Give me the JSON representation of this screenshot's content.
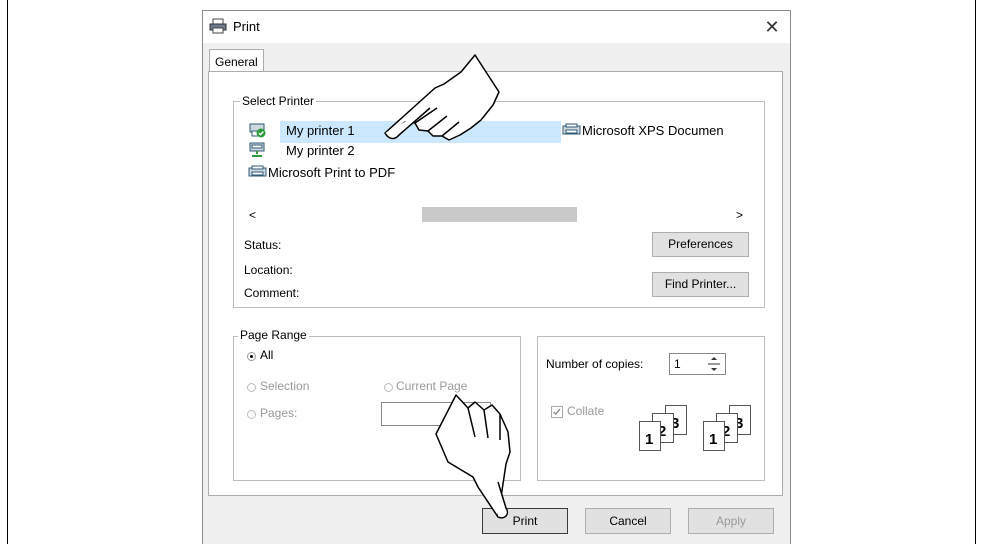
{
  "window": {
    "title": "Print",
    "close_glyph": "✕"
  },
  "tabs": [
    {
      "label": "General"
    }
  ],
  "select_printer": {
    "legend": "Select Printer",
    "printers": [
      {
        "name": "My printer 1",
        "icon": "printer-default-icon",
        "selected": true
      },
      {
        "name": "My printer 2",
        "icon": "printer-network-icon"
      },
      {
        "name": "Microsoft Print to PDF",
        "icon": "printer-icon"
      },
      {
        "name": "Microsoft XPS Documen",
        "icon": "printer-icon"
      }
    ],
    "scroll_left": "<",
    "scroll_right": ">",
    "status_label": "Status:",
    "location_label": "Location:",
    "comment_label": "Comment:",
    "preferences_button": "Preferences",
    "find_printer_button": "Find Printer..."
  },
  "page_range": {
    "legend": "Page Range",
    "all": "All",
    "selection": "Selection",
    "current_page": "Current Page",
    "pages": "Pages:",
    "selected": "All"
  },
  "copies": {
    "label": "Number of copies:",
    "value": "1",
    "collate_label": "Collate",
    "collate_checked": true,
    "collate_pages": [
      "1",
      "2",
      "3"
    ]
  },
  "footer": {
    "print_button": "Print",
    "cancel_button": "Cancel",
    "apply_button": "Apply"
  },
  "colors": {
    "selection_highlight": "#cce8ff",
    "dialog_bg": "#f0f0f0",
    "printer_green": "#2a9d3a"
  }
}
